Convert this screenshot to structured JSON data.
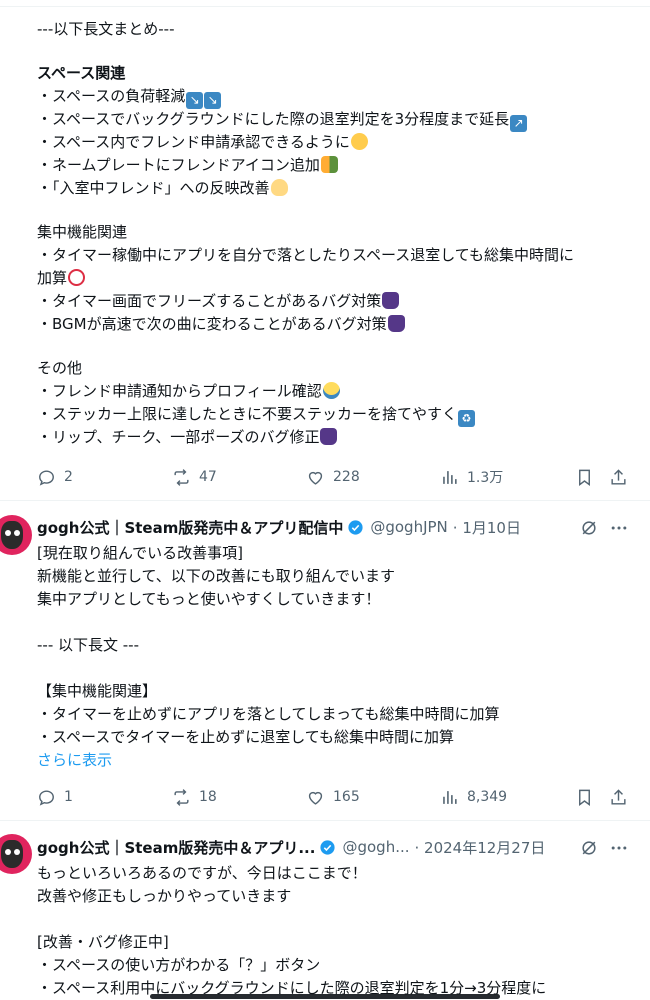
{
  "post1": {
    "lines": [
      "---以下長文まとめ---",
      "",
      "スペース関連",
      "・スペースの負荷軽減",
      "・スペースでバックグラウンドにした際の退室判定を3分程度まで延長",
      "・スペース内でフレンド申請承認できるように",
      "・ネームプレートにフレンドアイコン追加",
      "・「入室中フレンド」への反映改善",
      "",
      "集中機能関連",
      "・タイマー稼働中にアプリを自分で落としたりスペース退室しても総集中時間に",
      "加算",
      "・タイマー画面でフリーズすることがあるバグ対策",
      "・BGMが高速で次の曲に変わることがあるバグ対策",
      "",
      "その他",
      "・フレンド申請通知からプロフィール確認",
      "・ステッカー上限に達したときに不要ステッカーを捨てやすく",
      "・リップ、チーク、一部ポーズのバグ修正"
    ],
    "replies": "2",
    "reposts": "47",
    "likes": "228",
    "views": "1.3万"
  },
  "post2": {
    "name": "gogh公式｜Steam版発売中＆アプリ配信中",
    "handle": "@goghJPN",
    "date": "· 1月10日",
    "lines": [
      "[現在取り組んでいる改善事項]",
      "新機能と並行して、以下の改善にも取り組んでいます",
      "集中アプリとしてもっと使いやすくしていきます！",
      "",
      "--- 以下長文 ---",
      "",
      "【集中機能関連】",
      "・タイマーを止めずにアプリを落としてしまっても総集中時間に加算",
      "・スペースでタイマーを止めずに退室しても総集中時間に加算"
    ],
    "show_more": "さらに表示",
    "replies": "1",
    "reposts": "18",
    "likes": "165",
    "views": "8,349"
  },
  "post3": {
    "name": "gogh公式｜Steam版発売中＆アプリ...",
    "handle": "@gogh...",
    "date": "· 2024年12月27日",
    "lines": [
      "もっといろいろあるのですが、今日はここまで！",
      "改善や修正もしっかりやっていきます",
      "",
      "[改善・バグ修正中]",
      "・スペースの使い方がわかる「？」ボタン",
      "・スペース利用中にバックグラウンドにした際の退室判定を1分→3分程度に"
    ]
  },
  "icons": {
    "reply": "reply-icon",
    "repost": "repost-icon",
    "like": "like-icon",
    "views": "views-icon",
    "bookmark": "bookmark-icon",
    "share": "share-icon",
    "verified": "verified-badge-icon",
    "grok": "grok-icon",
    "more": "more-options-icon"
  },
  "colors": {
    "text": "#0f1419",
    "secondary": "#536471",
    "link": "#1d9bf0",
    "verified": "#1d9bf0",
    "divider": "#eff3f4"
  }
}
